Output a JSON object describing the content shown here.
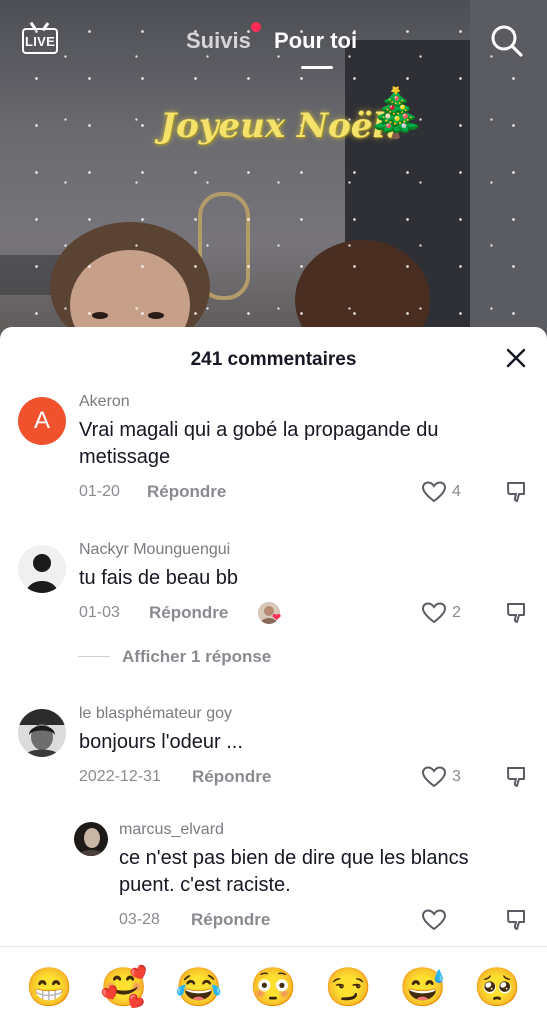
{
  "header": {
    "live_label": "LIVE",
    "tab_following": "Suivis",
    "tab_for_you": "Pour toi",
    "search_icon": "search-icon"
  },
  "video": {
    "overlay_text": "Joyeux Noël!",
    "overlay_emoji": "🎄"
  },
  "comments_panel": {
    "title": "241 commentaires",
    "close_icon": "close-icon",
    "reply_label": "Répondre",
    "comments": [
      {
        "username": "Akeron",
        "avatar_letter": "A",
        "text_line1": "Vrai magali qui a gobé la propagande du",
        "text_line2": "metissage",
        "date": "01-20",
        "likes": "4"
      },
      {
        "username": "Nackyr Mounguengui",
        "text_line1": "tu fais de beau bb",
        "date": "01-03",
        "likes": "2",
        "view_replies": "Afficher 1 réponse"
      },
      {
        "username": "le blasphémateur goy",
        "text_line1": "bonjours l'odeur ...",
        "date": "2022-12-31",
        "likes": "3"
      },
      {
        "username": "marcus_elvard",
        "text_line1": "ce n'est pas bien de dire que les blancs",
        "text_line2": "puent. c'est raciste.",
        "date": "03-28",
        "likes": ""
      }
    ]
  },
  "emoji_bar": [
    "😁",
    "🥰",
    "😂",
    "😳",
    "😏",
    "😅",
    "🥺"
  ],
  "colors": {
    "accent": "#ff2c55",
    "avatar_a": "#f0522e",
    "text_primary": "#161823",
    "text_secondary": "#8a8b91"
  }
}
